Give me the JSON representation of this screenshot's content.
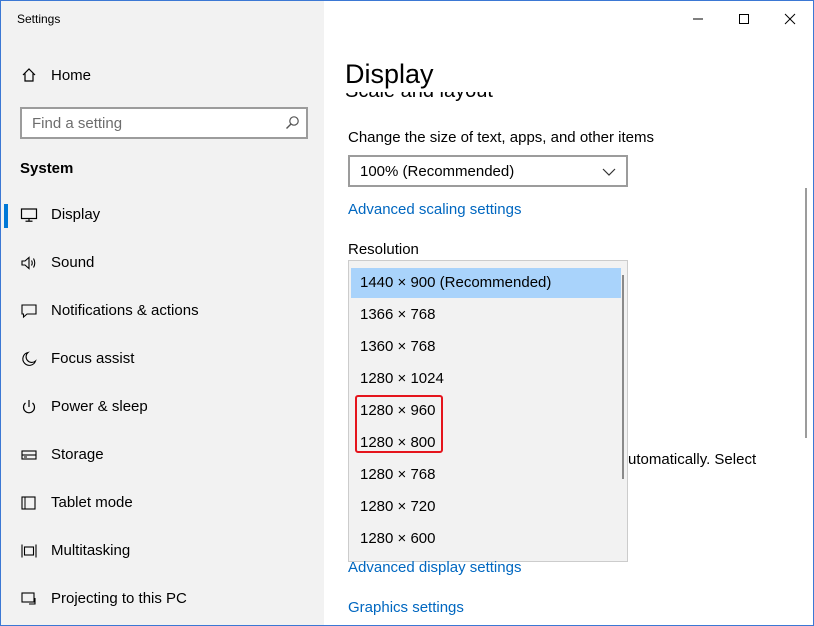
{
  "window": {
    "title": "Settings"
  },
  "sidebar": {
    "home_label": "Home",
    "search": {
      "placeholder": "Find a setting"
    },
    "section_heading": "System",
    "items": [
      {
        "label": "Display",
        "icon": "monitor-icon",
        "active": true
      },
      {
        "label": "Sound",
        "icon": "speaker-icon"
      },
      {
        "label": "Notifications & actions",
        "icon": "notifications-icon"
      },
      {
        "label": "Focus assist",
        "icon": "moon-icon"
      },
      {
        "label": "Power & sleep",
        "icon": "power-icon"
      },
      {
        "label": "Storage",
        "icon": "storage-icon"
      },
      {
        "label": "Tablet mode",
        "icon": "tablet-icon"
      },
      {
        "label": "Multitasking",
        "icon": "multitasking-icon"
      },
      {
        "label": "Projecting to this PC",
        "icon": "projecting-icon"
      }
    ]
  },
  "main": {
    "page_title": "Display",
    "section_heading": "Scale and layout",
    "scale_label": "Change the size of text, apps, and other items",
    "scale_value": "100% (Recommended)",
    "advanced_scaling_link": "Advanced scaling settings",
    "resolution_label": "Resolution",
    "resolution_options": [
      "1440 × 900 (Recommended)",
      "1366 × 768",
      "1360 × 768",
      "1280 × 1024",
      "1280 × 960",
      "1280 × 800",
      "1280 × 768",
      "1280 × 720",
      "1280 × 600"
    ],
    "selected_resolution": "1440 × 900 (Recommended)",
    "partial_text": "utomatically. Select",
    "advanced_display_link": "Advanced display settings",
    "graphics_link": "Graphics settings"
  },
  "colors": {
    "accent": "#0078d7",
    "link": "#0067c0",
    "selection": "#a9d3fb",
    "highlight_annotation": "#e5141c",
    "sidebar_bg": "#f2f2f2"
  }
}
